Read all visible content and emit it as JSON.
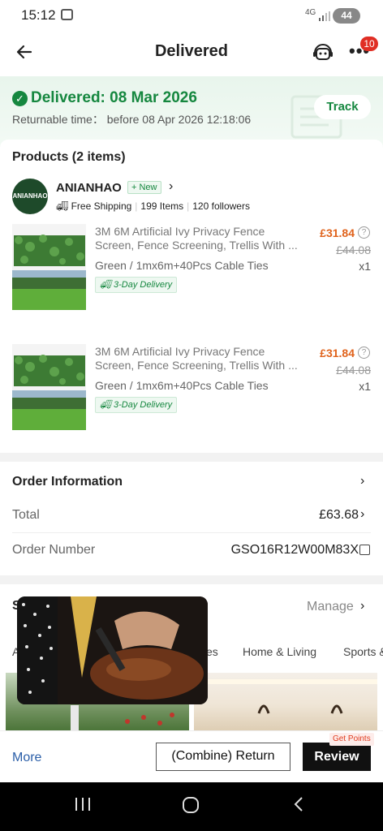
{
  "statusbar": {
    "time": "15:12",
    "network": "4G",
    "battery": "44"
  },
  "header": {
    "back_icon": "arrow-left-icon",
    "title": "Delivered",
    "support_icon": "headset-robot-icon",
    "more_icon": "more-dots-icon",
    "badge": "10"
  },
  "banner": {
    "status": "Delivered: 08 Mar 2026",
    "returnable": "Returnable time： before 08 Apr 2026 12:18:06",
    "track_label": "Track",
    "accent": "#15873f"
  },
  "products": {
    "title": "Products (2 items)",
    "store": {
      "logo_text": "ANIANHAO",
      "name": "ANIANHAO",
      "new_badge": "New",
      "shipping": "Free Shipping",
      "items": "199 Items",
      "followers": "120 followers"
    },
    "items": [
      {
        "title_line1": "3M 6M Artificial Ivy Privacy Fence",
        "title_line2": "Screen, Fence Screening, Trellis With ...",
        "variant": "Green / 1mx6m+40Pcs Cable Ties",
        "delivery": "3-Day Delivery",
        "price": "£31.84",
        "original_price": "£44.08",
        "qty": "x1"
      },
      {
        "title_line1": "3M 6M Artificial Ivy Privacy Fence",
        "title_line2": "Screen, Fence Screening, Trellis With ...",
        "variant": "Green / 1mx6m+40Pcs Cable Ties",
        "delivery": "3-Day Delivery",
        "price": "£31.84",
        "original_price": "£44.08",
        "qty": "x1"
      }
    ],
    "price_color": "#e0631c"
  },
  "order": {
    "title": "Order Information",
    "total_label": "Total",
    "total_value": "£63.68",
    "number_label": "Order Number",
    "number_value": "GSO16R12W00M83X"
  },
  "recommend": {
    "title_letter": "S",
    "manage": "Manage",
    "tabs": [
      "A",
      "es",
      "Home & Living",
      "Sports &"
    ]
  },
  "bottom": {
    "more": "More",
    "return_label": "(Combine) Return",
    "review_label": "Review",
    "points_tag": "Get Points"
  }
}
